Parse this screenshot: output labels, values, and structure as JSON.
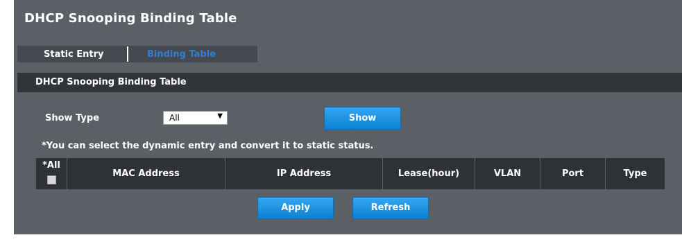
{
  "page": {
    "title": "DHCP Snooping Binding Table"
  },
  "tabs": [
    {
      "label": "Static Entry",
      "active": false
    },
    {
      "label": "Binding Table",
      "active": true
    }
  ],
  "section": {
    "title": "DHCP Snooping Binding Table"
  },
  "filter": {
    "show_type_label": "Show Type",
    "show_type_value": "All",
    "show_button": "Show"
  },
  "note": "*You can select the dynamic entry and convert it to static status.",
  "table": {
    "select_all_label": "*All",
    "columns": [
      "MAC Address",
      "IP Address",
      "Lease(hour)",
      "VLAN",
      "Port",
      "Type"
    ],
    "rows": []
  },
  "actions": {
    "apply": "Apply",
    "refresh": "Refresh"
  },
  "colors": {
    "panel_bg": "#5b5f66",
    "section_bar": "#313438",
    "table_header": "#2e3135",
    "button_blue": "#1a8fe3",
    "active_tab_text": "#2f7fd3"
  },
  "icons": {
    "dropdown": "triangle-down",
    "select_all": "checkbox"
  }
}
